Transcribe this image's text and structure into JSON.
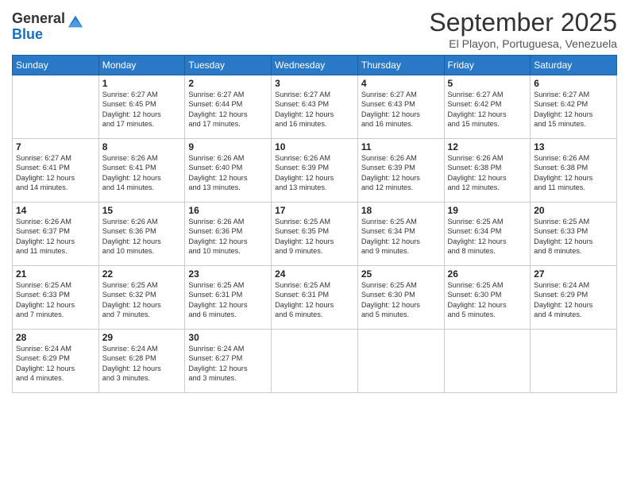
{
  "logo": {
    "general": "General",
    "blue": "Blue"
  },
  "title": "September 2025",
  "subtitle": "El Playon, Portuguesa, Venezuela",
  "weekdays": [
    "Sunday",
    "Monday",
    "Tuesday",
    "Wednesday",
    "Thursday",
    "Friday",
    "Saturday"
  ],
  "weeks": [
    [
      {
        "day": "",
        "detail": ""
      },
      {
        "day": "1",
        "detail": "Sunrise: 6:27 AM\nSunset: 6:45 PM\nDaylight: 12 hours\nand 17 minutes."
      },
      {
        "day": "2",
        "detail": "Sunrise: 6:27 AM\nSunset: 6:44 PM\nDaylight: 12 hours\nand 17 minutes."
      },
      {
        "day": "3",
        "detail": "Sunrise: 6:27 AM\nSunset: 6:43 PM\nDaylight: 12 hours\nand 16 minutes."
      },
      {
        "day": "4",
        "detail": "Sunrise: 6:27 AM\nSunset: 6:43 PM\nDaylight: 12 hours\nand 16 minutes."
      },
      {
        "day": "5",
        "detail": "Sunrise: 6:27 AM\nSunset: 6:42 PM\nDaylight: 12 hours\nand 15 minutes."
      },
      {
        "day": "6",
        "detail": "Sunrise: 6:27 AM\nSunset: 6:42 PM\nDaylight: 12 hours\nand 15 minutes."
      }
    ],
    [
      {
        "day": "7",
        "detail": "Sunrise: 6:27 AM\nSunset: 6:41 PM\nDaylight: 12 hours\nand 14 minutes."
      },
      {
        "day": "8",
        "detail": "Sunrise: 6:26 AM\nSunset: 6:41 PM\nDaylight: 12 hours\nand 14 minutes."
      },
      {
        "day": "9",
        "detail": "Sunrise: 6:26 AM\nSunset: 6:40 PM\nDaylight: 12 hours\nand 13 minutes."
      },
      {
        "day": "10",
        "detail": "Sunrise: 6:26 AM\nSunset: 6:39 PM\nDaylight: 12 hours\nand 13 minutes."
      },
      {
        "day": "11",
        "detail": "Sunrise: 6:26 AM\nSunset: 6:39 PM\nDaylight: 12 hours\nand 12 minutes."
      },
      {
        "day": "12",
        "detail": "Sunrise: 6:26 AM\nSunset: 6:38 PM\nDaylight: 12 hours\nand 12 minutes."
      },
      {
        "day": "13",
        "detail": "Sunrise: 6:26 AM\nSunset: 6:38 PM\nDaylight: 12 hours\nand 11 minutes."
      }
    ],
    [
      {
        "day": "14",
        "detail": "Sunrise: 6:26 AM\nSunset: 6:37 PM\nDaylight: 12 hours\nand 11 minutes."
      },
      {
        "day": "15",
        "detail": "Sunrise: 6:26 AM\nSunset: 6:36 PM\nDaylight: 12 hours\nand 10 minutes."
      },
      {
        "day": "16",
        "detail": "Sunrise: 6:26 AM\nSunset: 6:36 PM\nDaylight: 12 hours\nand 10 minutes."
      },
      {
        "day": "17",
        "detail": "Sunrise: 6:25 AM\nSunset: 6:35 PM\nDaylight: 12 hours\nand 9 minutes."
      },
      {
        "day": "18",
        "detail": "Sunrise: 6:25 AM\nSunset: 6:34 PM\nDaylight: 12 hours\nand 9 minutes."
      },
      {
        "day": "19",
        "detail": "Sunrise: 6:25 AM\nSunset: 6:34 PM\nDaylight: 12 hours\nand 8 minutes."
      },
      {
        "day": "20",
        "detail": "Sunrise: 6:25 AM\nSunset: 6:33 PM\nDaylight: 12 hours\nand 8 minutes."
      }
    ],
    [
      {
        "day": "21",
        "detail": "Sunrise: 6:25 AM\nSunset: 6:33 PM\nDaylight: 12 hours\nand 7 minutes."
      },
      {
        "day": "22",
        "detail": "Sunrise: 6:25 AM\nSunset: 6:32 PM\nDaylight: 12 hours\nand 7 minutes."
      },
      {
        "day": "23",
        "detail": "Sunrise: 6:25 AM\nSunset: 6:31 PM\nDaylight: 12 hours\nand 6 minutes."
      },
      {
        "day": "24",
        "detail": "Sunrise: 6:25 AM\nSunset: 6:31 PM\nDaylight: 12 hours\nand 6 minutes."
      },
      {
        "day": "25",
        "detail": "Sunrise: 6:25 AM\nSunset: 6:30 PM\nDaylight: 12 hours\nand 5 minutes."
      },
      {
        "day": "26",
        "detail": "Sunrise: 6:25 AM\nSunset: 6:30 PM\nDaylight: 12 hours\nand 5 minutes."
      },
      {
        "day": "27",
        "detail": "Sunrise: 6:24 AM\nSunset: 6:29 PM\nDaylight: 12 hours\nand 4 minutes."
      }
    ],
    [
      {
        "day": "28",
        "detail": "Sunrise: 6:24 AM\nSunset: 6:29 PM\nDaylight: 12 hours\nand 4 minutes."
      },
      {
        "day": "29",
        "detail": "Sunrise: 6:24 AM\nSunset: 6:28 PM\nDaylight: 12 hours\nand 3 minutes."
      },
      {
        "day": "30",
        "detail": "Sunrise: 6:24 AM\nSunset: 6:27 PM\nDaylight: 12 hours\nand 3 minutes."
      },
      {
        "day": "",
        "detail": ""
      },
      {
        "day": "",
        "detail": ""
      },
      {
        "day": "",
        "detail": ""
      },
      {
        "day": "",
        "detail": ""
      }
    ]
  ]
}
